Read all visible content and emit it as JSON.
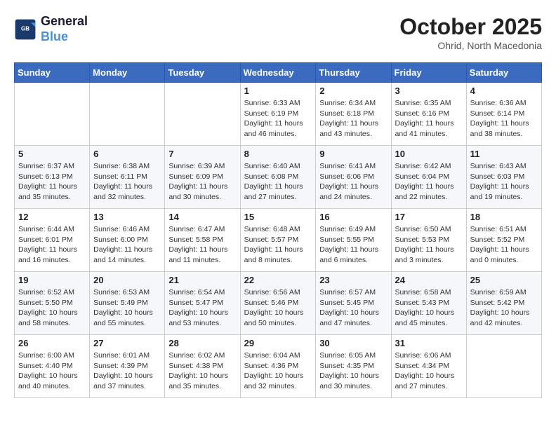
{
  "header": {
    "logo_line1": "General",
    "logo_line2": "Blue",
    "month": "October 2025",
    "location": "Ohrid, North Macedonia"
  },
  "weekdays": [
    "Sunday",
    "Monday",
    "Tuesday",
    "Wednesday",
    "Thursday",
    "Friday",
    "Saturday"
  ],
  "weeks": [
    [
      {
        "day": "",
        "info": ""
      },
      {
        "day": "",
        "info": ""
      },
      {
        "day": "",
        "info": ""
      },
      {
        "day": "1",
        "info": "Sunrise: 6:33 AM\nSunset: 6:19 PM\nDaylight: 11 hours and 46 minutes."
      },
      {
        "day": "2",
        "info": "Sunrise: 6:34 AM\nSunset: 6:18 PM\nDaylight: 11 hours and 43 minutes."
      },
      {
        "day": "3",
        "info": "Sunrise: 6:35 AM\nSunset: 6:16 PM\nDaylight: 11 hours and 41 minutes."
      },
      {
        "day": "4",
        "info": "Sunrise: 6:36 AM\nSunset: 6:14 PM\nDaylight: 11 hours and 38 minutes."
      }
    ],
    [
      {
        "day": "5",
        "info": "Sunrise: 6:37 AM\nSunset: 6:13 PM\nDaylight: 11 hours and 35 minutes."
      },
      {
        "day": "6",
        "info": "Sunrise: 6:38 AM\nSunset: 6:11 PM\nDaylight: 11 hours and 32 minutes."
      },
      {
        "day": "7",
        "info": "Sunrise: 6:39 AM\nSunset: 6:09 PM\nDaylight: 11 hours and 30 minutes."
      },
      {
        "day": "8",
        "info": "Sunrise: 6:40 AM\nSunset: 6:08 PM\nDaylight: 11 hours and 27 minutes."
      },
      {
        "day": "9",
        "info": "Sunrise: 6:41 AM\nSunset: 6:06 PM\nDaylight: 11 hours and 24 minutes."
      },
      {
        "day": "10",
        "info": "Sunrise: 6:42 AM\nSunset: 6:04 PM\nDaylight: 11 hours and 22 minutes."
      },
      {
        "day": "11",
        "info": "Sunrise: 6:43 AM\nSunset: 6:03 PM\nDaylight: 11 hours and 19 minutes."
      }
    ],
    [
      {
        "day": "12",
        "info": "Sunrise: 6:44 AM\nSunset: 6:01 PM\nDaylight: 11 hours and 16 minutes."
      },
      {
        "day": "13",
        "info": "Sunrise: 6:46 AM\nSunset: 6:00 PM\nDaylight: 11 hours and 14 minutes."
      },
      {
        "day": "14",
        "info": "Sunrise: 6:47 AM\nSunset: 5:58 PM\nDaylight: 11 hours and 11 minutes."
      },
      {
        "day": "15",
        "info": "Sunrise: 6:48 AM\nSunset: 5:57 PM\nDaylight: 11 hours and 8 minutes."
      },
      {
        "day": "16",
        "info": "Sunrise: 6:49 AM\nSunset: 5:55 PM\nDaylight: 11 hours and 6 minutes."
      },
      {
        "day": "17",
        "info": "Sunrise: 6:50 AM\nSunset: 5:53 PM\nDaylight: 11 hours and 3 minutes."
      },
      {
        "day": "18",
        "info": "Sunrise: 6:51 AM\nSunset: 5:52 PM\nDaylight: 11 hours and 0 minutes."
      }
    ],
    [
      {
        "day": "19",
        "info": "Sunrise: 6:52 AM\nSunset: 5:50 PM\nDaylight: 10 hours and 58 minutes."
      },
      {
        "day": "20",
        "info": "Sunrise: 6:53 AM\nSunset: 5:49 PM\nDaylight: 10 hours and 55 minutes."
      },
      {
        "day": "21",
        "info": "Sunrise: 6:54 AM\nSunset: 5:47 PM\nDaylight: 10 hours and 53 minutes."
      },
      {
        "day": "22",
        "info": "Sunrise: 6:56 AM\nSunset: 5:46 PM\nDaylight: 10 hours and 50 minutes."
      },
      {
        "day": "23",
        "info": "Sunrise: 6:57 AM\nSunset: 5:45 PM\nDaylight: 10 hours and 47 minutes."
      },
      {
        "day": "24",
        "info": "Sunrise: 6:58 AM\nSunset: 5:43 PM\nDaylight: 10 hours and 45 minutes."
      },
      {
        "day": "25",
        "info": "Sunrise: 6:59 AM\nSunset: 5:42 PM\nDaylight: 10 hours and 42 minutes."
      }
    ],
    [
      {
        "day": "26",
        "info": "Sunrise: 6:00 AM\nSunset: 4:40 PM\nDaylight: 10 hours and 40 minutes."
      },
      {
        "day": "27",
        "info": "Sunrise: 6:01 AM\nSunset: 4:39 PM\nDaylight: 10 hours and 37 minutes."
      },
      {
        "day": "28",
        "info": "Sunrise: 6:02 AM\nSunset: 4:38 PM\nDaylight: 10 hours and 35 minutes."
      },
      {
        "day": "29",
        "info": "Sunrise: 6:04 AM\nSunset: 4:36 PM\nDaylight: 10 hours and 32 minutes."
      },
      {
        "day": "30",
        "info": "Sunrise: 6:05 AM\nSunset: 4:35 PM\nDaylight: 10 hours and 30 minutes."
      },
      {
        "day": "31",
        "info": "Sunrise: 6:06 AM\nSunset: 4:34 PM\nDaylight: 10 hours and 27 minutes."
      },
      {
        "day": "",
        "info": ""
      }
    ]
  ]
}
